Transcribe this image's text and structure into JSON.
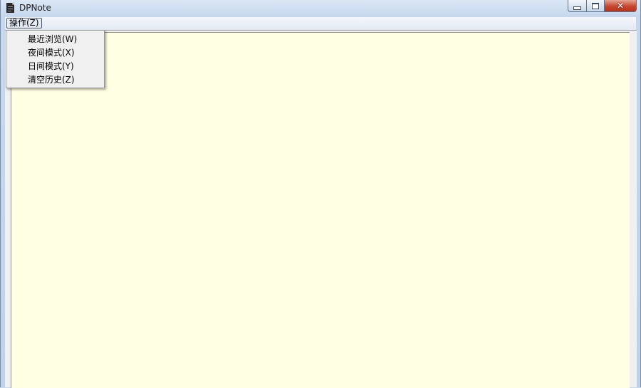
{
  "window": {
    "title": "DPNote",
    "icon": "document-icon",
    "caption_buttons": {
      "minimize": "minimize-icon",
      "maximize": "maximize-icon",
      "close": "close-icon"
    }
  },
  "menubar": {
    "items": [
      {
        "label": "操作(Z)"
      }
    ]
  },
  "dropdown": {
    "items": [
      {
        "label": "最近浏览(W)"
      },
      {
        "label": "夜间模式(X)"
      },
      {
        "label": "日间模式(Y)"
      },
      {
        "label": "清空历史(Z)"
      }
    ]
  },
  "editor": {
    "text": "",
    "background_color": "#ffffe3"
  }
}
